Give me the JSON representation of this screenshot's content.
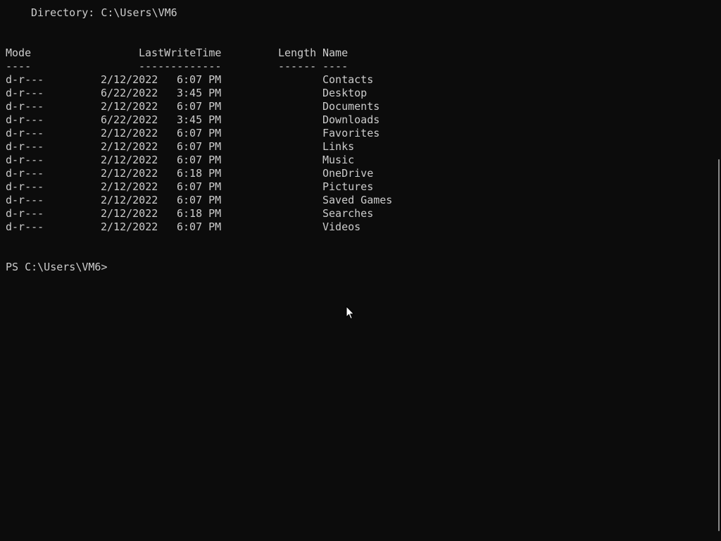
{
  "directory": {
    "label": "Directory: C:\\Users\\VM6"
  },
  "headers": {
    "mode": "Mode",
    "lastwritetime": "LastWriteTime",
    "length": "Length",
    "name": "Name"
  },
  "underlines": {
    "mode": "----",
    "lastwritetime": "-------------",
    "length": "------",
    "name": "----"
  },
  "rows": [
    {
      "mode": "d-r---",
      "date": "2/12/2022",
      "time": "6:07 PM",
      "length": "",
      "name": "Contacts"
    },
    {
      "mode": "d-r---",
      "date": "6/22/2022",
      "time": "3:45 PM",
      "length": "",
      "name": "Desktop"
    },
    {
      "mode": "d-r---",
      "date": "2/12/2022",
      "time": "6:07 PM",
      "length": "",
      "name": "Documents"
    },
    {
      "mode": "d-r---",
      "date": "6/22/2022",
      "time": "3:45 PM",
      "length": "",
      "name": "Downloads"
    },
    {
      "mode": "d-r---",
      "date": "2/12/2022",
      "time": "6:07 PM",
      "length": "",
      "name": "Favorites"
    },
    {
      "mode": "d-r---",
      "date": "2/12/2022",
      "time": "6:07 PM",
      "length": "",
      "name": "Links"
    },
    {
      "mode": "d-r---",
      "date": "2/12/2022",
      "time": "6:07 PM",
      "length": "",
      "name": "Music"
    },
    {
      "mode": "d-r---",
      "date": "2/12/2022",
      "time": "6:18 PM",
      "length": "",
      "name": "OneDrive"
    },
    {
      "mode": "d-r---",
      "date": "2/12/2022",
      "time": "6:07 PM",
      "length": "",
      "name": "Pictures"
    },
    {
      "mode": "d-r---",
      "date": "2/12/2022",
      "time": "6:07 PM",
      "length": "",
      "name": "Saved Games"
    },
    {
      "mode": "d-r---",
      "date": "2/12/2022",
      "time": "6:18 PM",
      "length": "",
      "name": "Searches"
    },
    {
      "mode": "d-r---",
      "date": "2/12/2022",
      "time": "6:07 PM",
      "length": "",
      "name": "Videos"
    }
  ],
  "prompt": {
    "text": "PS C:\\Users\\VM6>"
  },
  "icons": {
    "pointer": "mouse-pointer-icon"
  },
  "colors": {
    "background": "#0c0c0c",
    "foreground": "#cccccc"
  }
}
